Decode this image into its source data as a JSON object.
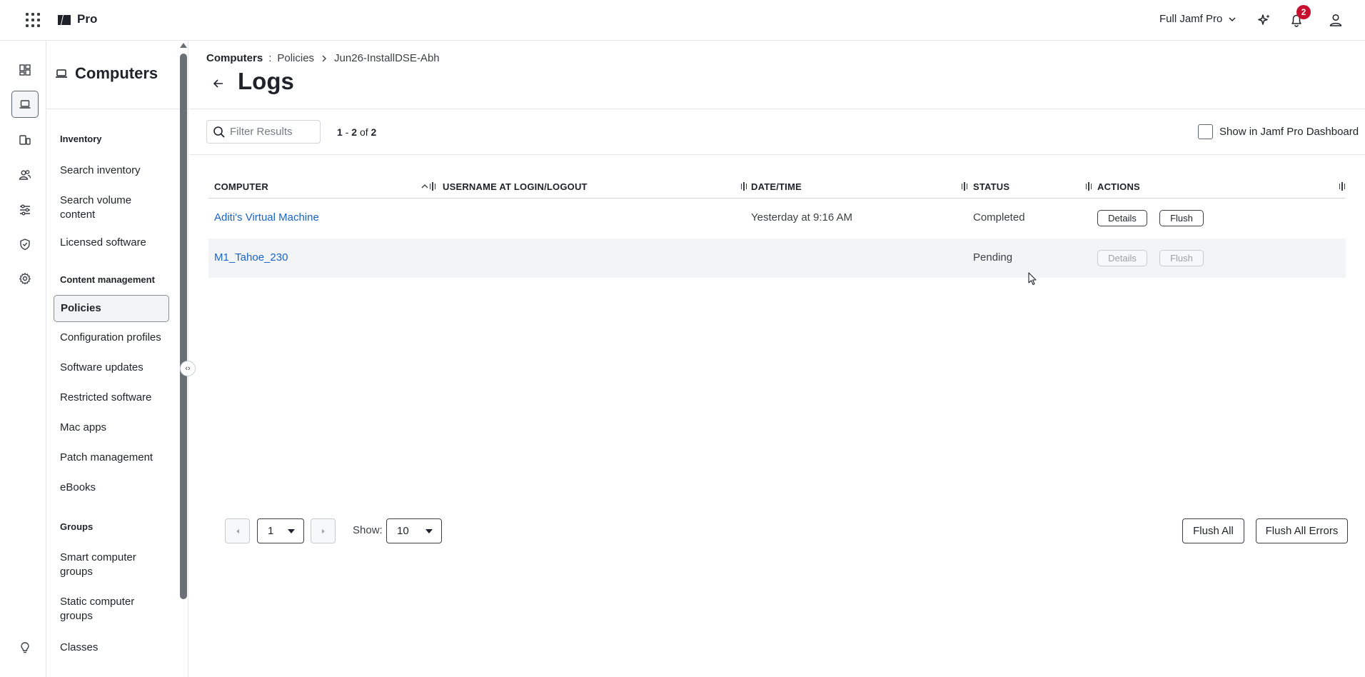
{
  "topbar": {
    "product": "Pro",
    "environment": "Full Jamf Pro",
    "notification_count": "2"
  },
  "sidebar": {
    "title": "Computers",
    "sections": [
      {
        "label": "Inventory",
        "items": [
          "Search inventory",
          "Search volume content",
          "Licensed software"
        ]
      },
      {
        "label": "Content management",
        "items": [
          "Policies",
          "Configuration profiles",
          "Software updates",
          "Restricted software",
          "Mac apps",
          "Patch management",
          "eBooks"
        ]
      },
      {
        "label": "Groups",
        "items": [
          "Smart computer groups",
          "Static computer groups",
          "Classes"
        ]
      }
    ],
    "active_item": "Policies"
  },
  "breadcrumb": [
    "Computers",
    "Policies",
    "Jun26-InstallDSE-Abh"
  ],
  "page_title": "Logs",
  "toolbar": {
    "filter_placeholder": "Filter Results",
    "count_start": "1",
    "count_end": "2",
    "count_total": "2",
    "count_sep": "-",
    "count_of": "of",
    "dashboard_label": "Show in Jamf Pro Dashboard"
  },
  "table": {
    "headers": [
      "COMPUTER",
      "USERNAME AT LOGIN/LOGOUT",
      "DATE/TIME",
      "STATUS",
      "ACTIONS"
    ],
    "rows": [
      {
        "computer": "Aditi's Virtual Machine",
        "username": "",
        "datetime": "Yesterday at 9:16 AM",
        "status": "Completed",
        "details": "Details",
        "flush": "Flush",
        "actions_enabled": true
      },
      {
        "computer": "M1_Tahoe_230",
        "username": "",
        "datetime": "",
        "status": "Pending",
        "details": "Details",
        "flush": "Flush",
        "actions_enabled": false
      }
    ]
  },
  "footer": {
    "page": "1",
    "show_label": "Show:",
    "page_size": "10",
    "flush_all": "Flush All",
    "flush_all_errors": "Flush All Errors"
  },
  "colors": {
    "link": "#1a63c8",
    "badge": "#c8102e",
    "border": "#e3e5e8"
  }
}
